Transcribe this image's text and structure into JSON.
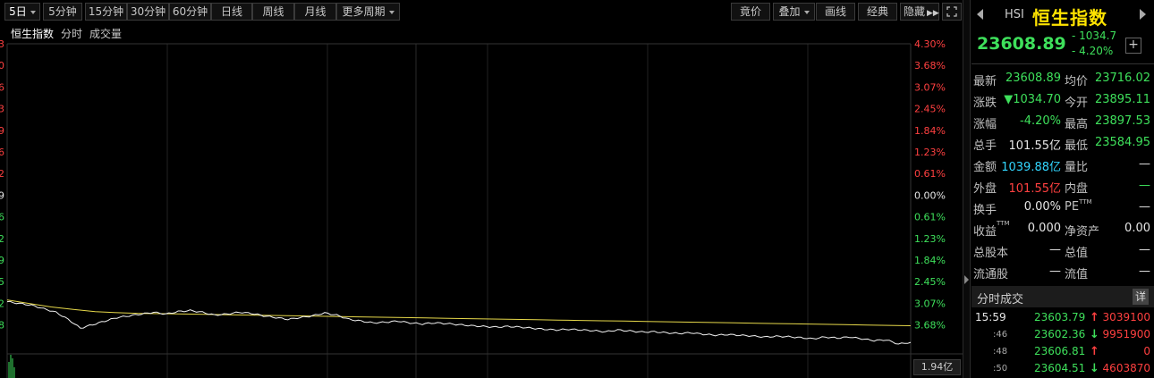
{
  "toolbar": {
    "left_buttons": [
      {
        "label": "5日",
        "dropdown": true
      },
      {
        "label": "5分钟"
      },
      {
        "label": "15分钟"
      },
      {
        "label": "30分钟"
      },
      {
        "label": "60分钟"
      },
      {
        "label": "日线"
      },
      {
        "label": "周线"
      },
      {
        "label": "月线"
      },
      {
        "label": "更多周期",
        "dropdown": true
      }
    ],
    "right_buttons": [
      {
        "label": "竟价"
      },
      {
        "label": "叠加",
        "dropdown": true
      },
      {
        "label": "画线"
      },
      {
        "label": "经典"
      },
      {
        "label": "隐藏"
      }
    ]
  },
  "chart_header": {
    "index_name": "恒生指数",
    "mode": "分时",
    "volume": "成交量"
  },
  "chart_data": {
    "type": "line",
    "right_axis_labels": [
      {
        "text": "4.30%",
        "color": "#ff4040"
      },
      {
        "text": "3.68%",
        "color": "#ff4040"
      },
      {
        "text": "3.07%",
        "color": "#ff4040"
      },
      {
        "text": "2.45%",
        "color": "#ff4040"
      },
      {
        "text": "1.84%",
        "color": "#ff4040"
      },
      {
        "text": "1.23%",
        "color": "#ff4040"
      },
      {
        "text": "0.61%",
        "color": "#ff4040"
      },
      {
        "text": "0.00%",
        "color": "#e6e6e6"
      },
      {
        "text": "0.61%",
        "color": "#3ee05b"
      },
      {
        "text": "1.23%",
        "color": "#3ee05b"
      },
      {
        "text": "1.84%",
        "color": "#3ee05b"
      },
      {
        "text": "2.45%",
        "color": "#3ee05b"
      },
      {
        "text": "3.07%",
        "color": "#3ee05b"
      },
      {
        "text": "3.68%",
        "color": "#3ee05b"
      }
    ],
    "left_axis_partial": [
      "3",
      "0",
      "6",
      "3",
      "9",
      "6",
      "2",
      "9",
      "6",
      "2",
      "9",
      "5",
      "2",
      "8"
    ],
    "left_axis_colors": [
      "#ff4040",
      "#ff4040",
      "#ff4040",
      "#ff4040",
      "#ff4040",
      "#ff4040",
      "#ff4040",
      "#e6e6e6",
      "#3ee05b",
      "#3ee05b",
      "#3ee05b",
      "#3ee05b",
      "#3ee05b",
      "#3ee05b"
    ],
    "ylim_pct": [
      -4.3,
      4.3
    ],
    "price_series_pct": [
      -3.0,
      -3.05,
      -3.1,
      -3.2,
      -3.3,
      -3.5,
      -3.75,
      -3.65,
      -3.55,
      -3.45,
      -3.4,
      -3.35,
      -3.3,
      -3.35,
      -3.28,
      -3.25,
      -3.3,
      -3.38,
      -3.35,
      -3.3,
      -3.33,
      -3.4,
      -3.45,
      -3.5,
      -3.45,
      -3.4,
      -3.32,
      -3.38,
      -3.5,
      -3.55,
      -3.6,
      -3.58,
      -3.55,
      -3.6,
      -3.63,
      -3.6,
      -3.62,
      -3.65,
      -3.68,
      -3.7,
      -3.72,
      -3.7,
      -3.72,
      -3.75,
      -3.78,
      -3.8,
      -3.78,
      -3.8,
      -3.82,
      -3.85,
      -3.8,
      -3.83,
      -3.86,
      -3.85,
      -3.88,
      -3.9,
      -3.88,
      -3.92,
      -3.95,
      -3.93,
      -3.95,
      -3.97,
      -4.0,
      -3.98,
      -3.99,
      -4.02,
      -4.05,
      -4.0,
      -4.03,
      -4.0,
      -4.05,
      -4.1,
      -4.08,
      -4.2,
      -4.15
    ],
    "avg_series_pct": [
      -2.95,
      -3.05,
      -3.15,
      -3.22,
      -3.28,
      -3.31,
      -3.33,
      -3.34,
      -3.35,
      -3.36,
      -3.37,
      -3.38,
      -3.39,
      -3.4,
      -3.41,
      -3.42,
      -3.43,
      -3.44,
      -3.45,
      -3.46,
      -3.47,
      -3.48,
      -3.49,
      -3.5,
      -3.51,
      -3.52,
      -3.53,
      -3.54,
      -3.55,
      -3.56,
      -3.57,
      -3.58,
      -3.59,
      -3.6,
      -3.61,
      -3.62,
      -3.63,
      -3.64,
      -3.65,
      -3.66,
      -3.67,
      -3.68
    ],
    "grid": true
  },
  "volume_label": "1.94亿",
  "panel": {
    "code": "HSI",
    "name": "恒生指数",
    "price": "23608.89",
    "change": "- 1034.7",
    "change_pct": "- 4.20%",
    "plus": "+",
    "quote_rows": [
      {
        "l1": "最新",
        "v1": "23608.89",
        "c1": "dn",
        "l2": "均价",
        "v2": "23716.02",
        "c2": "dn"
      },
      {
        "l1": "涨跌",
        "v1": "▼1034.70",
        "c1": "dn",
        "l2": "今开",
        "v2": "23895.11",
        "c2": "dn"
      },
      {
        "l1": "涨幅",
        "v1": "-4.20%",
        "c1": "dn",
        "l2": "最高",
        "v2": "23897.53",
        "c2": "dn"
      },
      {
        "l1": "总手",
        "v1": "101.55亿",
        "c1": "wh",
        "l2": "最低",
        "v2": "23584.95",
        "c2": "dn"
      },
      {
        "l1": "金额",
        "v1": "1039.88亿",
        "c1": "cy",
        "l2": "量比",
        "v2": "—",
        "c2": "wh"
      },
      {
        "l1": "外盘",
        "v1": "101.55亿",
        "c1": "up",
        "l2": "内盘",
        "v2": "—",
        "c2": "dn"
      },
      {
        "l1": "换手",
        "v1": "0.00%",
        "c1": "wh",
        "l2": "PE",
        "l2sup": "TTM",
        "v2": "—",
        "c2": "wh"
      },
      {
        "l1": "收益",
        "l1sup": "TTM",
        "v1": "0.000",
        "c1": "wh",
        "l2": "净资产",
        "v2": "0.00",
        "c2": "wh"
      },
      {
        "l1": "总股本",
        "v1": "—",
        "c1": "wh",
        "l2": "总值",
        "v2": "—",
        "c2": "wh"
      },
      {
        "l1": "流通股",
        "v1": "—",
        "c1": "wh",
        "l2": "流值",
        "v2": "—",
        "c2": "wh"
      }
    ],
    "ticks_title": "分时成交",
    "ticks_detail": "详",
    "ticks": [
      {
        "time": "15:59",
        "small": false,
        "price": "23603.79",
        "dir": "↑",
        "dir_color": "up",
        "vol": "3039100",
        "vol_color": "up"
      },
      {
        "time": ":46",
        "small": true,
        "price": "23602.36",
        "dir": "↓",
        "dir_color": "dn",
        "vol": "9951900",
        "vol_color": "up"
      },
      {
        "time": ":48",
        "small": true,
        "price": "23606.81",
        "dir": "↑",
        "dir_color": "up",
        "vol": "0",
        "vol_color": "up"
      },
      {
        "time": ":50",
        "small": true,
        "price": "23604.51",
        "dir": "↓",
        "dir_color": "dn",
        "vol": "4603870",
        "vol_color": "up"
      }
    ]
  }
}
